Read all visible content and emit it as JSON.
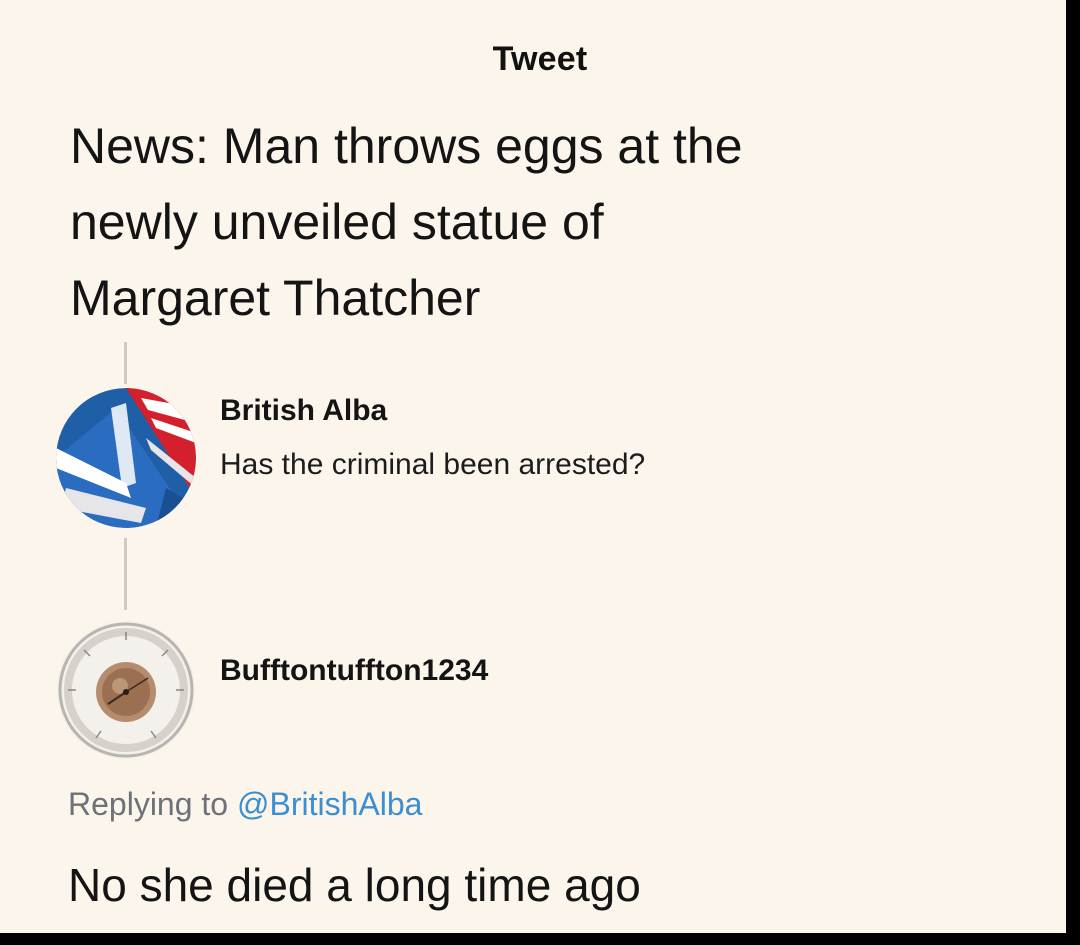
{
  "header": {
    "title": "Tweet"
  },
  "tweet": {
    "lines": [
      "News: Man throws eggs at the",
      "newly unveiled statue of",
      "Margaret Thatcher"
    ]
  },
  "replies": [
    {
      "name": "British Alba",
      "text": "Has the criminal been arrested?",
      "avatar_icon": "union-flag-saltire-avatar"
    },
    {
      "name": "Bufftontuffton1234",
      "avatar_icon": "barometer-avatar"
    }
  ],
  "final_reply": {
    "replying_prefix": "Replying to",
    "mention": "@BritishAlba",
    "text": "No she died a long time ago"
  },
  "colors": {
    "background": "#fbf5ec",
    "frame": "#000000",
    "mention": "#3b8fd0",
    "muted": "#6e7278"
  }
}
